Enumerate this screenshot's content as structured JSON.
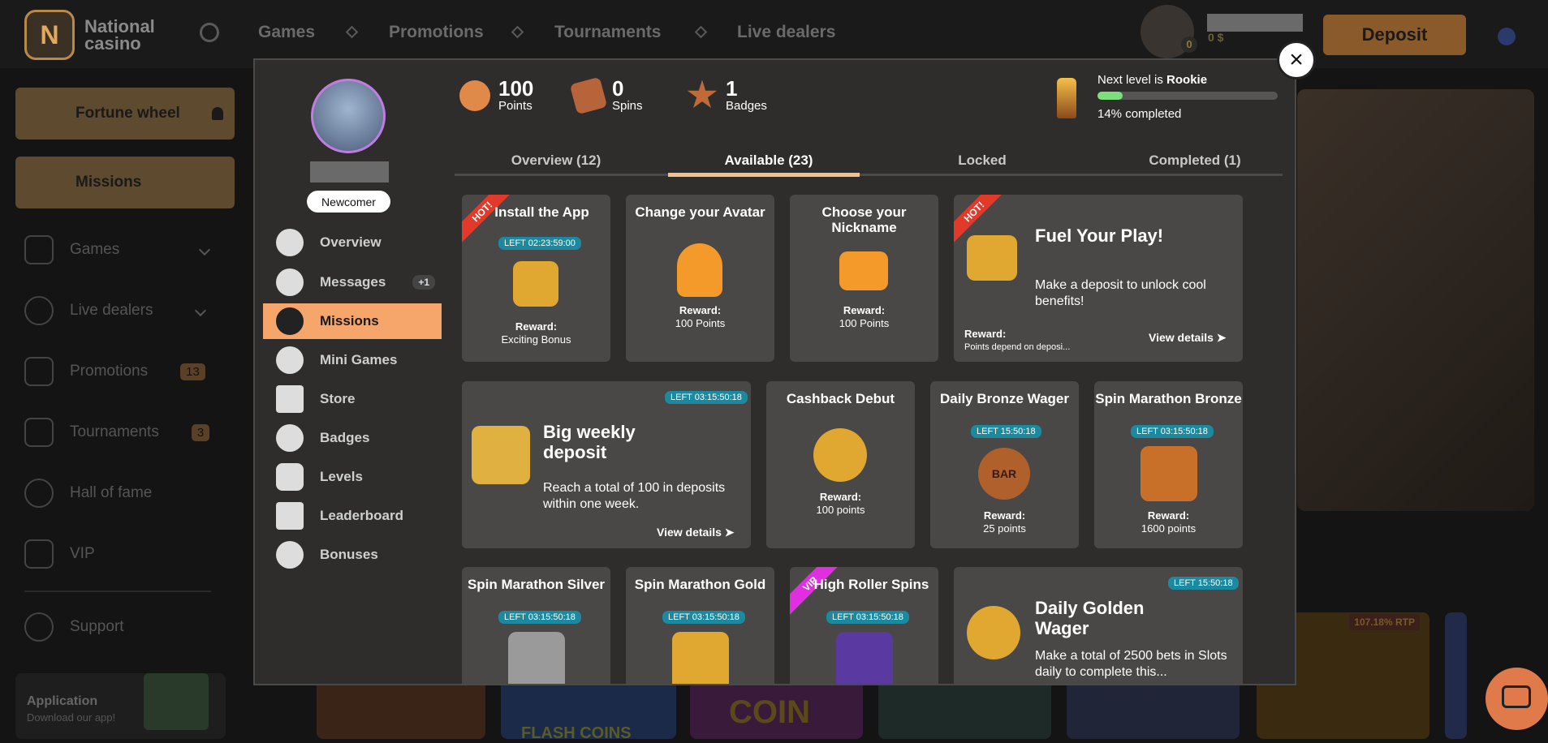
{
  "header": {
    "logo_line1": "National",
    "logo_line2": "casino",
    "nav": [
      "Games",
      "Promotions",
      "Tournaments",
      "Live dealers"
    ],
    "avatar_badge": "0",
    "balance": "0 $",
    "deposit_label": "Deposit"
  },
  "sidebar": {
    "fortune": "Fortune wheel",
    "missions": "Missions",
    "items": [
      {
        "label": "Games"
      },
      {
        "label": "Live dealers"
      },
      {
        "label": "Promotions",
        "badge": "13"
      },
      {
        "label": "Tournaments",
        "badge": "3"
      },
      {
        "label": "Hall of fame"
      },
      {
        "label": "VIP"
      }
    ],
    "support": "Support",
    "app_title": "Application",
    "app_sub": "Download our app!"
  },
  "background": {
    "rtp": "107.18% RTP",
    "coin_text": "COIN",
    "flash_text": "FLASH COINS"
  },
  "modal": {
    "close": "×",
    "level_name": "Newcomer",
    "menu": [
      {
        "label": "Overview"
      },
      {
        "label": "Messages",
        "badge": "+1"
      },
      {
        "label": "Missions"
      },
      {
        "label": "Mini Games"
      },
      {
        "label": "Store"
      },
      {
        "label": "Badges"
      },
      {
        "label": "Levels"
      },
      {
        "label": "Leaderboard"
      },
      {
        "label": "Bonuses"
      }
    ],
    "stats": [
      {
        "value": "100",
        "label": "Points"
      },
      {
        "value": "0",
        "label": "Spins"
      },
      {
        "value": "1",
        "label": "Badges"
      }
    ],
    "next_level_prefix": "Next level is ",
    "next_level": "Rookie",
    "progress": 0.14,
    "progress_text": "14% completed",
    "tabs": [
      "Overview (12)",
      "Available (23)",
      "Locked",
      "Completed (1)"
    ],
    "cards": [
      {
        "title": "Install the App",
        "ribbon": "HOT!",
        "timer": "LEFT 02:23:59:00",
        "reward_label": "Reward:",
        "reward": "Exciting Bonus"
      },
      {
        "title": "Change your Avatar",
        "reward_label": "Reward:",
        "reward": "100 Points"
      },
      {
        "title": "Choose your Nickname",
        "reward_label": "Reward:",
        "reward": "100 Points"
      },
      {
        "title": "Fuel Your Play!",
        "ribbon": "HOT!",
        "desc": "Make a deposit to unlock cool benefits!",
        "reward_label": "Reward:",
        "reward": "Points depend on deposi...",
        "view": "View details"
      },
      {
        "title": "Big weekly deposit",
        "timer": "LEFT 03:15:50:18",
        "desc": "Reach a total of 100 in deposits within one week.",
        "view": "View details"
      },
      {
        "title": "Cashback Debut",
        "reward_label": "Reward:",
        "reward": "100 points"
      },
      {
        "title": "Daily Bronze Wager",
        "timer": "LEFT 15:50:18",
        "reward_label": "Reward:",
        "reward": "25 points",
        "icon_text": "BAR"
      },
      {
        "title": "Spin Marathon Bronze",
        "timer": "LEFT 03:15:50:18",
        "reward_label": "Reward:",
        "reward": "1600 points"
      },
      {
        "title": "Spin Marathon Silver",
        "timer": "LEFT 03:15:50:18"
      },
      {
        "title": "Spin Marathon Gold",
        "timer": "LEFT 03:15:50:18"
      },
      {
        "title": "High Roller Spins",
        "ribbon": "VIP",
        "timer": "LEFT 03:15:50:18"
      },
      {
        "title": "Daily Golden Wager",
        "timer": "LEFT 15:50:18",
        "desc": "Make a total of 2500 bets in Slots daily to complete this..."
      }
    ]
  }
}
